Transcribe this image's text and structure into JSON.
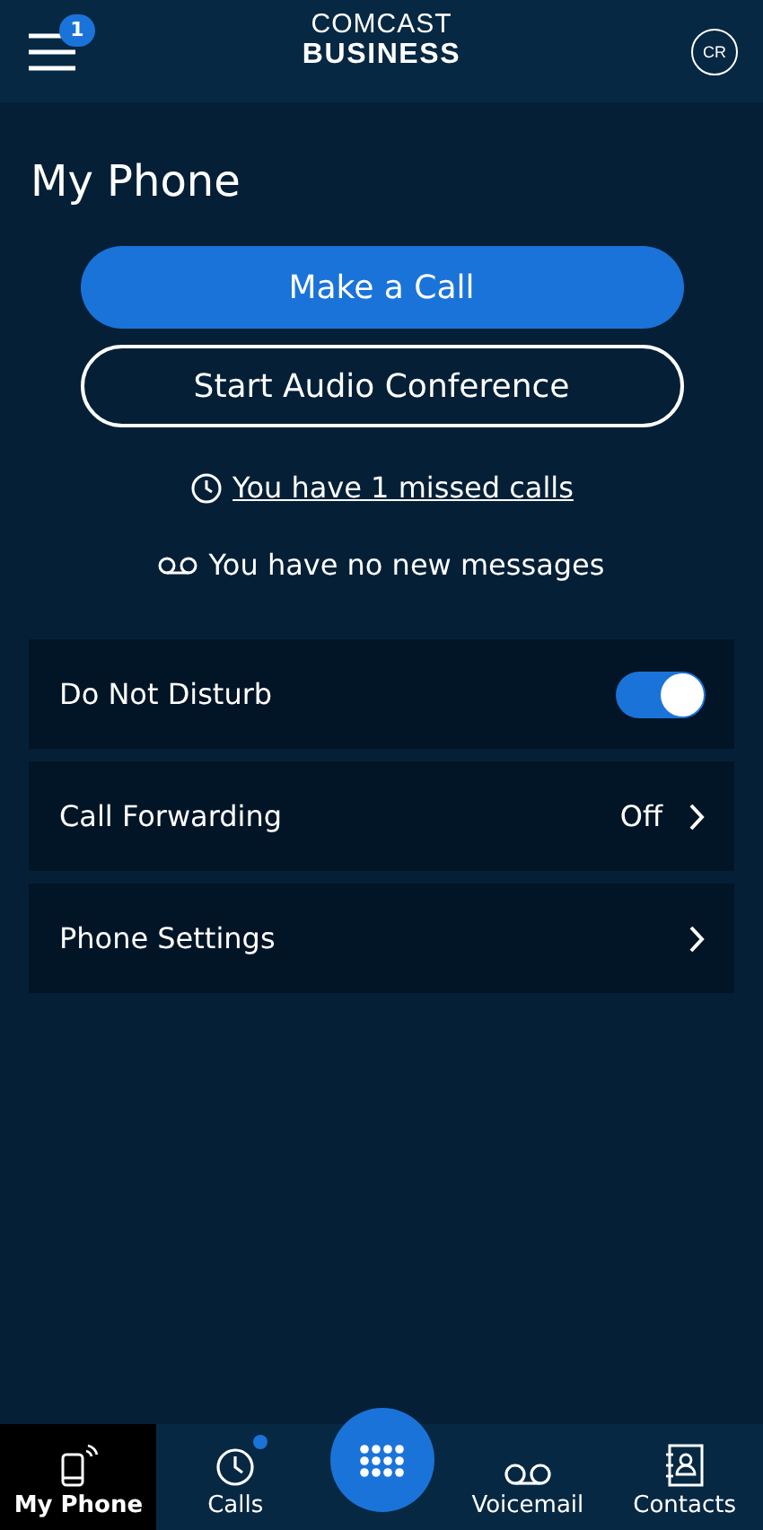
{
  "header": {
    "menu_badge": "1",
    "logo": [
      "COMCAST",
      "BUSINESS"
    ],
    "avatar": "CR"
  },
  "title": "My Phone",
  "actions": [
    {
      "label": "Make a Call",
      "kind": "primary"
    },
    {
      "label": "Start Audio Conference",
      "kind": "outline"
    }
  ],
  "notices": [
    {
      "text": "You have 1 missed calls",
      "kind": "link"
    },
    {
      "text": "You have no new messages",
      "kind": "plain"
    }
  ],
  "settings": [
    {
      "label": "Do Not Disturb",
      "kind": "toggle",
      "on": true
    },
    {
      "label": "Call Forwarding",
      "kind": "link",
      "value": "Off"
    },
    {
      "label": "Phone Settings",
      "kind": "link"
    }
  ],
  "nav": [
    {
      "label": "My Phone",
      "kind": "phone",
      "selected": true,
      "dot": false
    },
    {
      "label": "Calls",
      "kind": "clock",
      "selected": false,
      "dot": true
    },
    {
      "kind": "dialpad"
    },
    {
      "label": "Voicemail",
      "kind": "voicemail",
      "selected": false,
      "dot": false
    },
    {
      "label": "Contacts",
      "kind": "contacts",
      "selected": false,
      "dot": false
    }
  ]
}
